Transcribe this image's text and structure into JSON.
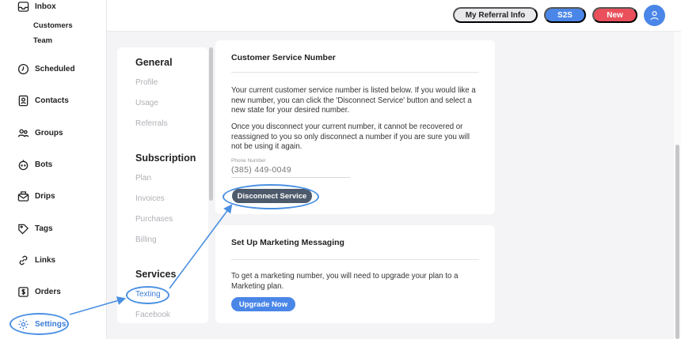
{
  "sidebar": {
    "items": [
      {
        "key": "inbox",
        "label": "Inbox",
        "icon": "inbox-icon"
      },
      {
        "key": "scheduled",
        "label": "Scheduled",
        "icon": "clock-icon"
      },
      {
        "key": "contacts",
        "label": "Contacts",
        "icon": "contact-card-icon"
      },
      {
        "key": "groups",
        "label": "Groups",
        "icon": "groups-icon"
      },
      {
        "key": "bots",
        "label": "Bots",
        "icon": "bot-icon"
      },
      {
        "key": "drips",
        "label": "Drips",
        "icon": "drip-mail-icon"
      },
      {
        "key": "tags",
        "label": "Tags",
        "icon": "tag-icon"
      },
      {
        "key": "links",
        "label": "Links",
        "icon": "link-icon"
      },
      {
        "key": "orders",
        "label": "Orders",
        "icon": "dollar-icon"
      },
      {
        "key": "settings",
        "label": "Settings",
        "icon": "gear-icon"
      }
    ],
    "inbox_sub": [
      "Customers",
      "Team"
    ]
  },
  "header": {
    "referral_label": "My Referral Info",
    "s2s_label": "S2S",
    "new_label": "New",
    "avatar_icon": "user-icon"
  },
  "settings_menu": {
    "general": {
      "heading": "General",
      "items": [
        "Profile",
        "Usage",
        "Referrals"
      ]
    },
    "subscription": {
      "heading": "Subscription",
      "items": [
        "Plan",
        "Invoices",
        "Purchases",
        "Billing"
      ]
    },
    "services": {
      "heading": "Services",
      "items": [
        "Texting",
        "Facebook"
      ],
      "active": "Texting"
    }
  },
  "customer_service": {
    "title": "Customer Service Number",
    "paragraph1": "Your current customer service number is listed below. If you would like a new number, you can click the 'Disconnect Service' button and select a new state for your desired number.",
    "paragraph2": "Once you disconnect your current number, it cannot be recovered or reassigned to you so only disconnect a number if you are sure you will not be using it again.",
    "phone_label": "Phone Number",
    "phone_value": "(385) 449-0049",
    "disconnect_label": "Disconnect Service"
  },
  "marketing": {
    "title": "Set Up Marketing Messaging",
    "text": "To get a marketing number, you will need to upgrade your plan to a Marketing plan.",
    "upgrade_label": "Upgrade Now"
  },
  "colors": {
    "accent": "#4a86e8",
    "new_button": "#e9505b",
    "disconnect_button": "#4d5a6b",
    "annotation": "#4a90e2"
  }
}
